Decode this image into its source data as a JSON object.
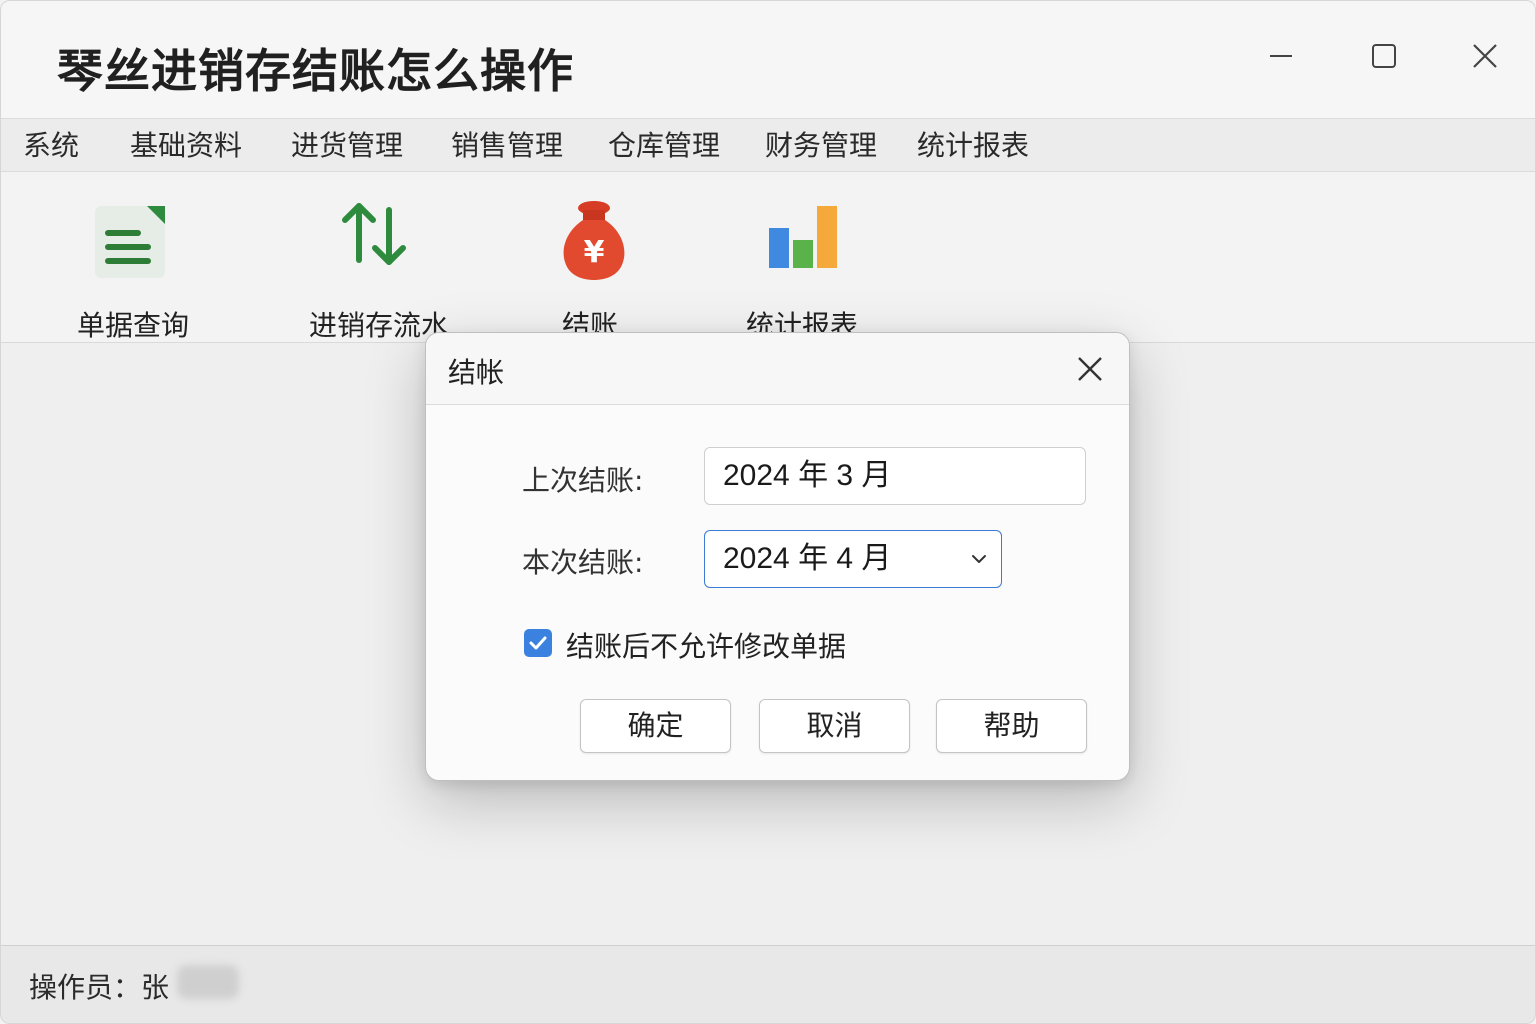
{
  "window": {
    "title": "琴丝进销存结账怎么操作"
  },
  "menu": {
    "items": [
      "系统",
      "基础资料",
      "进货管理",
      "销售管理",
      "仓库管理",
      "财务管理",
      "统计报表"
    ]
  },
  "toolbar": {
    "tools": [
      {
        "label": "单据查询",
        "icon": "document-list-icon"
      },
      {
        "label": "进销存流水",
        "icon": "up-down-arrows-icon"
      },
      {
        "label": "结账",
        "icon": "money-bag-icon"
      },
      {
        "label": "统计报表",
        "icon": "bar-chart-icon"
      }
    ]
  },
  "dialog": {
    "title": "结帐",
    "last_close_label": "上次结账:",
    "last_close_value": "2024 年 3 月",
    "current_close_label": "本次结账:",
    "current_close_value": "2024 年 4 月",
    "lock_checkbox_label": "结账后不允许修改单据",
    "lock_checkbox_checked": true,
    "buttons": {
      "confirm": "确定",
      "cancel": "取消",
      "help": "帮助"
    }
  },
  "status": {
    "operator_label": "操作员：张"
  },
  "colors": {
    "accent": "#3b82e0",
    "green": "#2e8b3e",
    "money_bag": "#e24a2f",
    "chart_blue": "#3f8ae0",
    "chart_green": "#59b34a",
    "chart_orange": "#f4a93a"
  }
}
